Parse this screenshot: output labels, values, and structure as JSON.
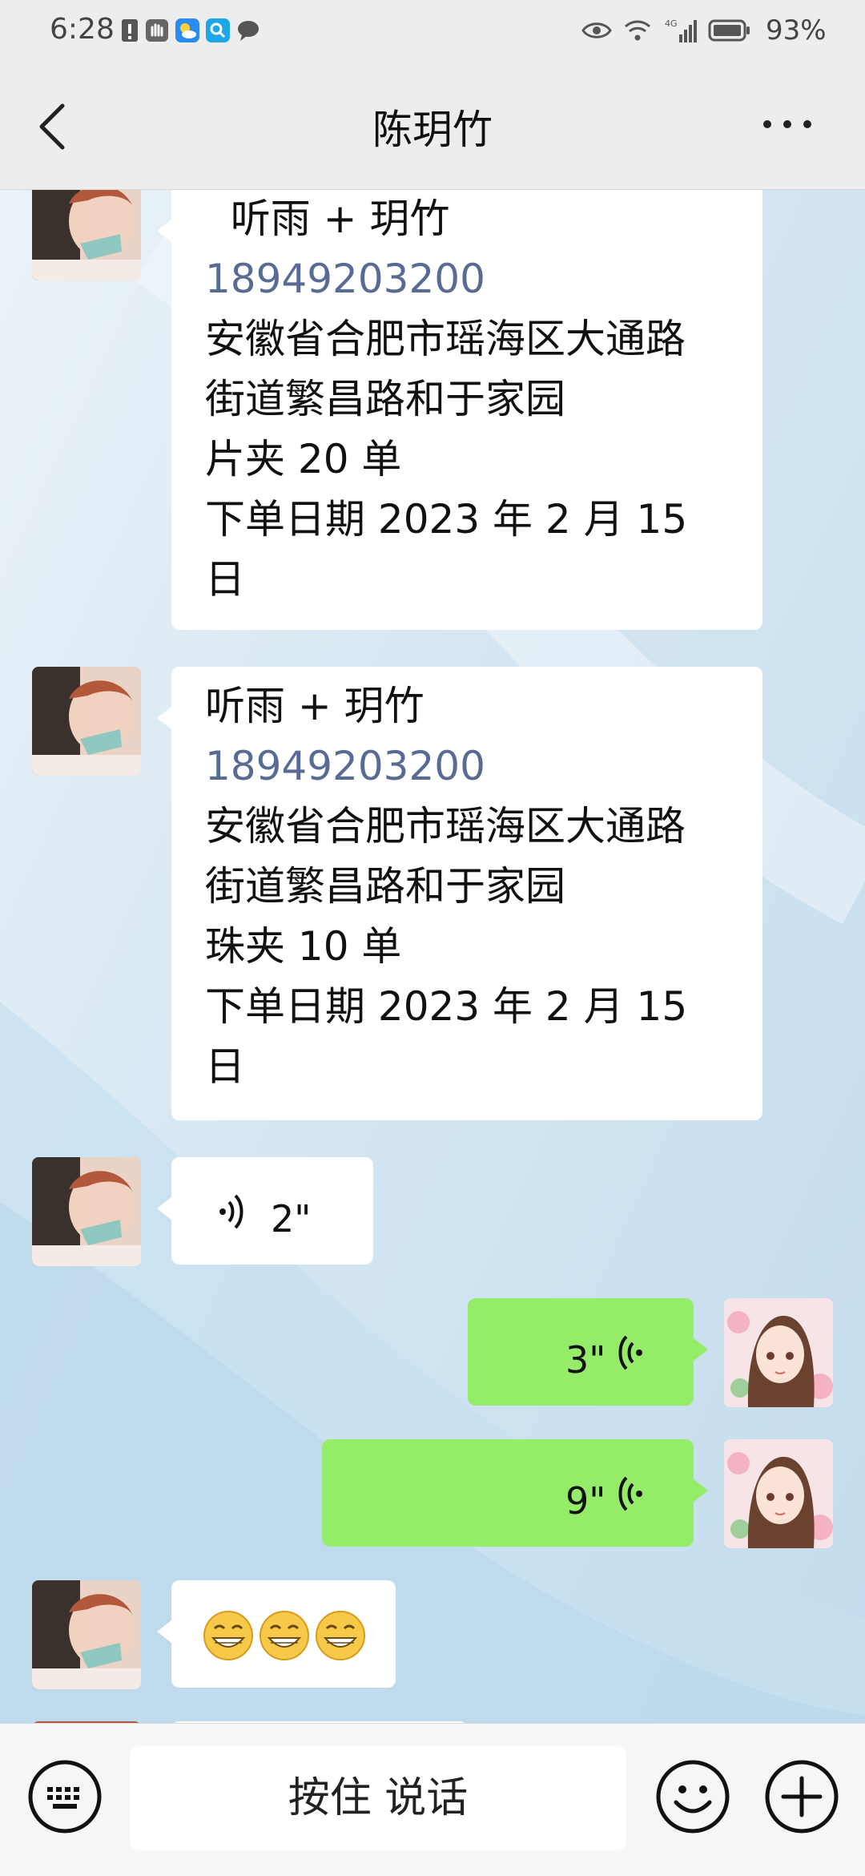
{
  "status_bar": {
    "time": "6:28",
    "network": "4G",
    "battery": "93%"
  },
  "nav": {
    "title": "陈玥竹",
    "back_icon": "chevron-left-icon",
    "more_icon": "ellipsis-icon"
  },
  "messages": [
    {
      "sender": "them",
      "lines": [
        "  听雨 + 玥竹",
        "18949203200",
        "安徽省合肥市瑶海区大通路",
        "街道繁昌路和于家园",
        "片夹 20 单",
        "下单日期 2023 年 2 月 15",
        "日"
      ]
    },
    {
      "sender": "them",
      "lines": [
        "听雨 + 玥竹",
        "18949203200",
        "安徽省合肥市瑶海区大通路",
        "街道繁昌路和于家园",
        "珠夹 10 单",
        "下单日期 2023 年 2 月 15",
        "日"
      ]
    },
    {
      "sender": "them",
      "type": "voice",
      "duration": "2\""
    },
    {
      "sender": "me",
      "type": "voice",
      "duration": "3\""
    },
    {
      "sender": "me",
      "type": "voice",
      "duration": "9\""
    },
    {
      "sender": "them",
      "type": "emoji",
      "emojis": [
        "😁",
        "😁",
        "😁"
      ]
    }
  ],
  "input": {
    "hold_to_talk": "按住 说话",
    "keyboard_icon": "keyboard-icon",
    "emoji_icon": "smiley-icon",
    "plus_icon": "plus-circle-icon"
  },
  "colors": {
    "header_bg": "#ededed",
    "my_bubble": "#95ec69",
    "their_bubble": "#ffffff",
    "phone_link": "#576b95"
  }
}
